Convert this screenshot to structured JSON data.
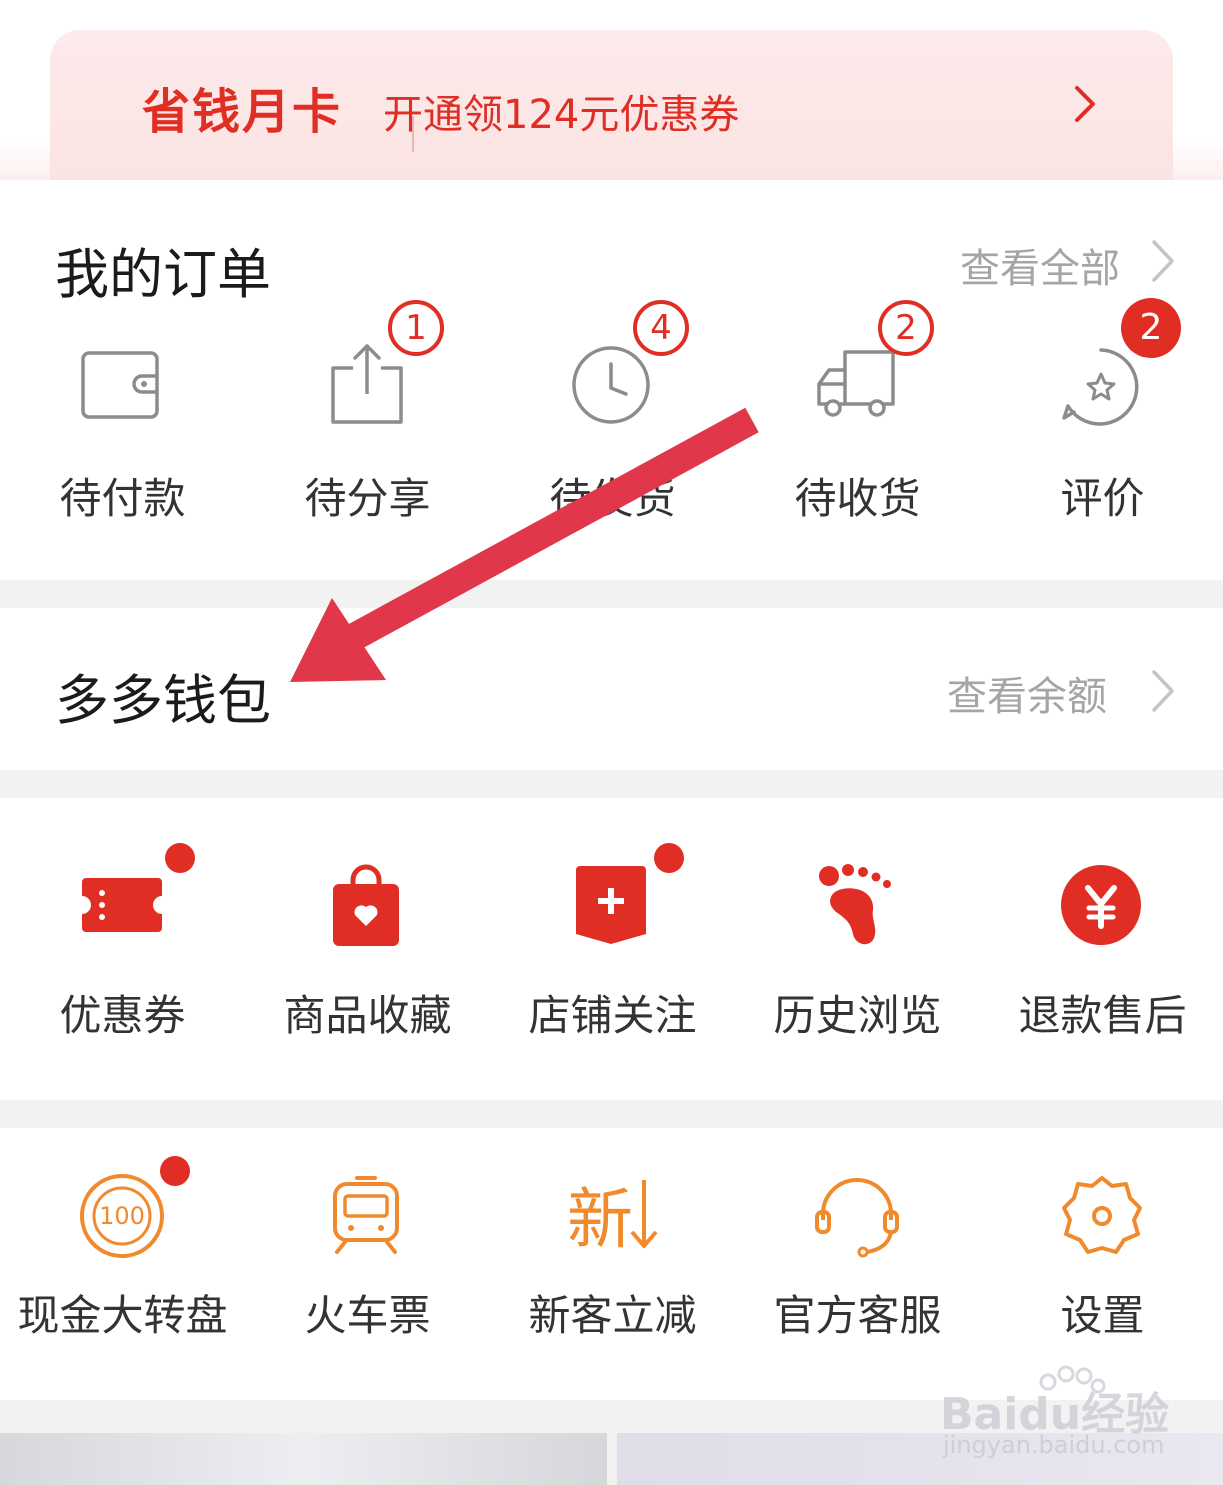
{
  "vip_banner": {
    "title": "省钱月卡",
    "subtitle": "开通领124元优惠券"
  },
  "orders": {
    "title": "我的订单",
    "view_all": "查看全部",
    "items": [
      {
        "label": "待付款",
        "icon": "wallet-icon",
        "badge": ""
      },
      {
        "label": "待分享",
        "icon": "share-icon",
        "badge": "1"
      },
      {
        "label": "待发货",
        "icon": "clock-icon",
        "badge": "4"
      },
      {
        "label": "待收货",
        "icon": "truck-icon",
        "badge": "2"
      },
      {
        "label": "评价",
        "icon": "review-star-icon",
        "badge": "2"
      }
    ]
  },
  "wallet": {
    "title": "多多钱包",
    "view_balance": "查看余额"
  },
  "services": {
    "items": [
      {
        "label": "优惠券",
        "icon": "coupon-icon",
        "dot": true
      },
      {
        "label": "商品收藏",
        "icon": "favorite-bag-icon",
        "dot": false
      },
      {
        "label": "店铺关注",
        "icon": "store-follow-icon",
        "dot": true
      },
      {
        "label": "历史浏览",
        "icon": "footprint-icon",
        "dot": false
      },
      {
        "label": "退款售后",
        "icon": "refund-yen-icon",
        "dot": false
      }
    ]
  },
  "tools": {
    "items": [
      {
        "label": "现金大转盘",
        "icon": "cash-wheel-100-icon",
        "dot": true,
        "icon_text": "100"
      },
      {
        "label": "火车票",
        "icon": "train-icon",
        "dot": false
      },
      {
        "label": "新客立减",
        "icon": "new-customer-icon",
        "dot": false,
        "icon_text": "新"
      },
      {
        "label": "官方客服",
        "icon": "headset-icon",
        "dot": false
      },
      {
        "label": "设置",
        "icon": "settings-gear-icon",
        "dot": false
      }
    ]
  },
  "watermark": {
    "brand": "Baidu经验",
    "url": "jingyan.baidu.com"
  },
  "colors": {
    "accent": "#e02e24",
    "orange": "#f08a2c",
    "annotation_arrow": "#e0384a",
    "icon_gray": "#8c8c8c"
  }
}
